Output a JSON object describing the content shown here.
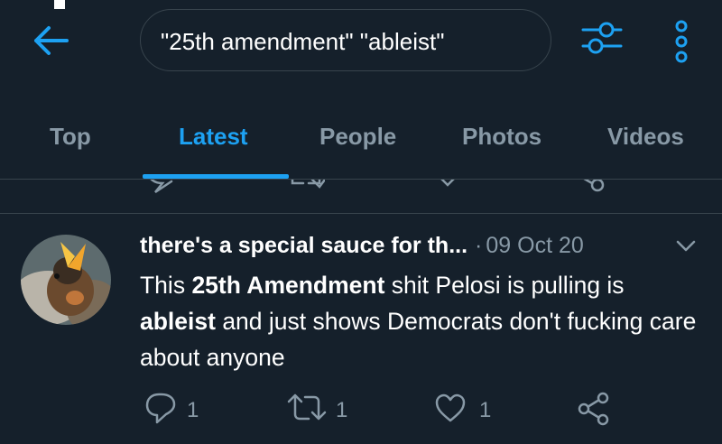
{
  "search": {
    "query": "\"25th amendment\" \"ableist\""
  },
  "tabs": [
    {
      "label": "Top",
      "active": false
    },
    {
      "label": "Latest",
      "active": true
    },
    {
      "label": "People",
      "active": false
    },
    {
      "label": "Photos",
      "active": false
    },
    {
      "label": "Videos",
      "active": false
    }
  ],
  "tweet": {
    "author": "there's a special sauce for th...",
    "separator": "·",
    "date": "09 Oct 20",
    "text_parts": [
      {
        "text": "This ",
        "bold": false
      },
      {
        "text": "25th Amendment",
        "bold": true
      },
      {
        "text": " shit Pelosi is pulling is ",
        "bold": false
      },
      {
        "text": "ableist",
        "bold": true
      },
      {
        "text": " and just shows Democrats don't fucking care about anyone",
        "bold": false
      }
    ],
    "replies": "1",
    "retweets": "1",
    "likes": "1"
  },
  "icons": {
    "back": "arrow-left-icon",
    "filter": "sliders-icon",
    "more": "more-vertical-icon",
    "reply": "reply-icon",
    "retweet": "retweet-icon",
    "like": "heart-icon",
    "share": "share-icon",
    "caret": "chevron-down-icon"
  },
  "colors": {
    "background": "#15202b",
    "accent": "#1da1f2",
    "secondary_text": "#8899a6",
    "divider": "#38444d"
  }
}
